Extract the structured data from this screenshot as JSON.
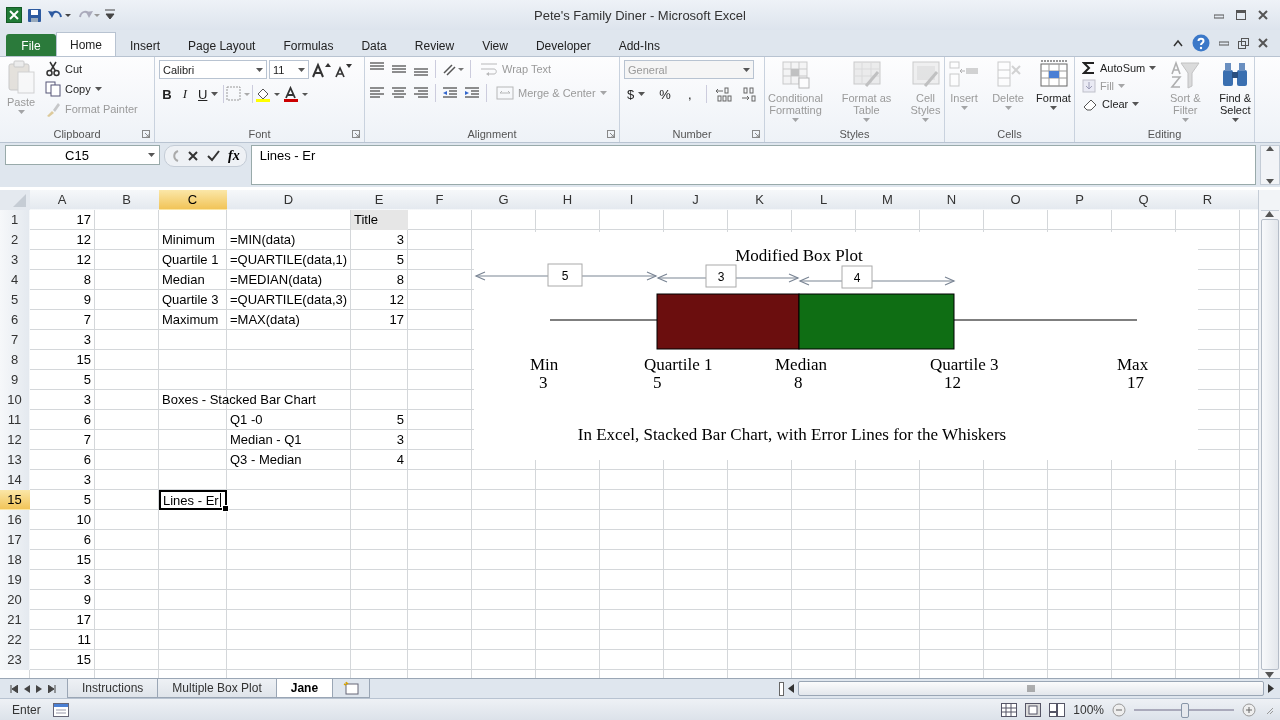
{
  "window": {
    "title": "Pete's Family Diner - Microsoft Excel"
  },
  "tabs": [
    {
      "label": "File",
      "kind": "file",
      "selected": false
    },
    {
      "label": "Home",
      "kind": "tab",
      "selected": true
    },
    {
      "label": "Insert",
      "kind": "tab",
      "selected": false
    },
    {
      "label": "Page Layout",
      "kind": "tab",
      "selected": false
    },
    {
      "label": "Formulas",
      "kind": "tab",
      "selected": false
    },
    {
      "label": "Data",
      "kind": "tab",
      "selected": false
    },
    {
      "label": "Review",
      "kind": "tab",
      "selected": false
    },
    {
      "label": "View",
      "kind": "tab",
      "selected": false
    },
    {
      "label": "Developer",
      "kind": "tab",
      "selected": false
    },
    {
      "label": "Add-Ins",
      "kind": "tab",
      "selected": false
    }
  ],
  "ribbon": {
    "groups": [
      {
        "kind": "clipboard",
        "label": "Clipboard",
        "items": [
          {
            "label": "Paste",
            "disabled": true
          },
          {
            "label": "Cut",
            "disabled": false
          },
          {
            "label": "Copy",
            "disabled": false
          },
          {
            "label": "Format Painter",
            "disabled": true
          }
        ]
      },
      {
        "kind": "font",
        "label": "Font",
        "font_name": "Calibri",
        "font_size": "11",
        "style_buttons": [
          "B",
          "I",
          "U"
        ]
      },
      {
        "kind": "alignment",
        "label": "Alignment",
        "items": [
          {
            "label": "Wrap Text",
            "disabled": true
          },
          {
            "label": "Merge & Center",
            "disabled": true
          }
        ]
      },
      {
        "kind": "number",
        "label": "Number",
        "format": "General",
        "format_disabled": true,
        "symbol_buttons": [
          "$",
          "%",
          ","
        ]
      },
      {
        "kind": "styles",
        "label": "Styles",
        "items": [
          {
            "label": "Conditional Formatting",
            "disabled": true
          },
          {
            "label": "Format as Table",
            "disabled": true
          },
          {
            "label": "Cell Styles",
            "disabled": true
          }
        ]
      },
      {
        "kind": "cells",
        "label": "Cells",
        "items": [
          {
            "label": "Insert",
            "disabled": true
          },
          {
            "label": "Delete",
            "disabled": true
          },
          {
            "label": "Format",
            "disabled": false
          }
        ]
      },
      {
        "kind": "editing",
        "label": "Editing",
        "items": [
          {
            "label": "AutoSum",
            "disabled": false
          },
          {
            "label": "Fill",
            "disabled": true
          },
          {
            "label": "Clear",
            "disabled": false
          },
          {
            "label": "Sort & Filter",
            "disabled": true
          },
          {
            "label": "Find & Select",
            "disabled": false
          }
        ]
      }
    ]
  },
  "formula_bar": {
    "name_box": "C15",
    "insert_function": "fx",
    "value": "Lines - Er"
  },
  "grid": {
    "columns": [
      {
        "label": "A",
        "selected": false
      },
      {
        "label": "B",
        "selected": false
      },
      {
        "label": "C",
        "selected": true
      },
      {
        "label": "D",
        "selected": false
      },
      {
        "label": "E",
        "selected": false
      },
      {
        "label": "F",
        "selected": false
      },
      {
        "label": "G",
        "selected": false
      },
      {
        "label": "H",
        "selected": false
      },
      {
        "label": "I",
        "selected": false
      },
      {
        "label": "J",
        "selected": false
      },
      {
        "label": "K",
        "selected": false
      },
      {
        "label": "L",
        "selected": false
      },
      {
        "label": "M",
        "selected": false
      },
      {
        "label": "N",
        "selected": false
      },
      {
        "label": "O",
        "selected": false
      },
      {
        "label": "P",
        "selected": false
      },
      {
        "label": "Q",
        "selected": false
      },
      {
        "label": "R",
        "selected": false
      }
    ],
    "rows": [
      {
        "header": "1",
        "selected": false,
        "cells": {
          "A": {
            "value": "17",
            "kind": "number"
          },
          "E": {
            "value": "Title",
            "kind": "header"
          }
        }
      },
      {
        "header": "2",
        "selected": false,
        "cells": {
          "A": {
            "value": "12",
            "kind": "number"
          },
          "C": {
            "value": "Minimum",
            "kind": "text"
          },
          "D": {
            "value": "=MIN(data)",
            "kind": "text"
          },
          "E": {
            "value": "3",
            "kind": "number"
          }
        }
      },
      {
        "header": "3",
        "selected": false,
        "cells": {
          "A": {
            "value": "12",
            "kind": "number"
          },
          "C": {
            "value": "Quartile 1",
            "kind": "text"
          },
          "D": {
            "value": "=QUARTILE(data,1)",
            "kind": "text"
          },
          "E": {
            "value": "5",
            "kind": "number"
          }
        }
      },
      {
        "header": "4",
        "selected": false,
        "cells": {
          "A": {
            "value": "8",
            "kind": "number"
          },
          "C": {
            "value": "Median",
            "kind": "text"
          },
          "D": {
            "value": "=MEDIAN(data)",
            "kind": "text"
          },
          "E": {
            "value": "8",
            "kind": "number"
          }
        }
      },
      {
        "header": "5",
        "selected": false,
        "cells": {
          "A": {
            "value": "9",
            "kind": "number"
          },
          "C": {
            "value": "Quartile 3",
            "kind": "text"
          },
          "D": {
            "value": "=QUARTILE(data,3)",
            "kind": "text"
          },
          "E": {
            "value": "12",
            "kind": "number"
          }
        }
      },
      {
        "header": "6",
        "selected": false,
        "cells": {
          "A": {
            "value": "7",
            "kind": "number"
          },
          "C": {
            "value": "Maximum",
            "kind": "text"
          },
          "D": {
            "value": "=MAX(data)",
            "kind": "text"
          },
          "E": {
            "value": "17",
            "kind": "number"
          }
        }
      },
      {
        "header": "7",
        "selected": false,
        "cells": {
          "A": {
            "value": "3",
            "kind": "number"
          }
        }
      },
      {
        "header": "8",
        "selected": false,
        "cells": {
          "A": {
            "value": "15",
            "kind": "number"
          }
        }
      },
      {
        "header": "9",
        "selected": false,
        "cells": {
          "A": {
            "value": "5",
            "kind": "number"
          }
        }
      },
      {
        "header": "10",
        "selected": false,
        "cells": {
          "A": {
            "value": "3",
            "kind": "number"
          },
          "C": {
            "value": "Boxes - Stacked Bar Chart",
            "kind": "text"
          }
        }
      },
      {
        "header": "11",
        "selected": false,
        "cells": {
          "A": {
            "value": "6",
            "kind": "number"
          },
          "D": {
            "value": "Q1 -0",
            "kind": "text"
          },
          "E": {
            "value": "5",
            "kind": "number"
          }
        }
      },
      {
        "header": "12",
        "selected": false,
        "cells": {
          "A": {
            "value": "7",
            "kind": "number"
          },
          "D": {
            "value": "Median - Q1",
            "kind": "text"
          },
          "E": {
            "value": "3",
            "kind": "number"
          }
        }
      },
      {
        "header": "13",
        "selected": false,
        "cells": {
          "A": {
            "value": "6",
            "kind": "number"
          },
          "D": {
            "value": "Q3 - Median",
            "kind": "text"
          },
          "E": {
            "value": "4",
            "kind": "number"
          }
        }
      },
      {
        "header": "14",
        "selected": false,
        "cells": {
          "A": {
            "value": "3",
            "kind": "number"
          }
        }
      },
      {
        "header": "15",
        "selected": true,
        "cells": {
          "A": {
            "value": "5",
            "kind": "number"
          },
          "C": {
            "value": "Lines - Er",
            "kind": "editing"
          }
        }
      },
      {
        "header": "16",
        "selected": false,
        "cells": {
          "A": {
            "value": "10",
            "kind": "number"
          }
        }
      },
      {
        "header": "17",
        "selected": false,
        "cells": {
          "A": {
            "value": "6",
            "kind": "number"
          }
        }
      },
      {
        "header": "18",
        "selected": false,
        "cells": {
          "A": {
            "value": "15",
            "kind": "number"
          }
        }
      },
      {
        "header": "19",
        "selected": false,
        "cells": {
          "A": {
            "value": "3",
            "kind": "number"
          }
        }
      },
      {
        "header": "20",
        "selected": false,
        "cells": {
          "A": {
            "value": "9",
            "kind": "number"
          }
        }
      },
      {
        "header": "21",
        "selected": false,
        "cells": {
          "A": {
            "value": "17",
            "kind": "number"
          }
        }
      },
      {
        "header": "22",
        "selected": false,
        "cells": {
          "A": {
            "value": "11",
            "kind": "number"
          }
        }
      },
      {
        "header": "23",
        "selected": false,
        "cells": {
          "A": {
            "value": "15",
            "kind": "number"
          }
        }
      }
    ]
  },
  "chart": {
    "title": "Modified Box Plot",
    "range_labels": [
      "5",
      "3",
      "4"
    ],
    "boxes": [
      {
        "color": "#6b0e0e"
      },
      {
        "color": "#0f6e14"
      }
    ],
    "markers": [
      {
        "name": "Min",
        "value": "3"
      },
      {
        "name": "Quartile 1",
        "value": "5"
      },
      {
        "name": "Median",
        "value": "8"
      },
      {
        "name": "Quartile 3",
        "value": "12"
      },
      {
        "name": "Max",
        "value": "17"
      }
    ],
    "caption": "In Excel, Stacked Bar Chart, with Error Lines for the Whiskers"
  },
  "sheet_tabs": [
    {
      "label": "Instructions",
      "selected": false
    },
    {
      "label": "Multiple Box Plot",
      "selected": false
    },
    {
      "label": "Jane",
      "selected": true
    }
  ],
  "status_bar": {
    "mode": "Enter",
    "zoom": {
      "reading": "100%",
      "level": 0.5
    }
  }
}
